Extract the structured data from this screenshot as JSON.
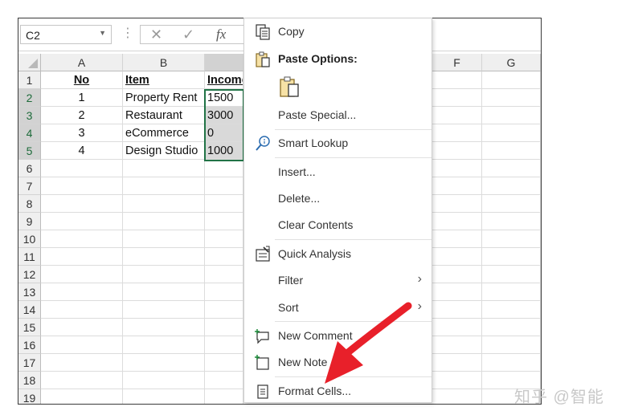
{
  "name_box": {
    "value": "C2"
  },
  "formula_bar": {
    "cancel": "✕",
    "enter": "✓",
    "fx": "fx"
  },
  "columns": [
    "A",
    "B",
    "Income",
    "",
    "",
    "F",
    "G"
  ],
  "rows": [
    "1",
    "2",
    "3",
    "4",
    "5",
    "6",
    "7",
    "8",
    "9",
    "10",
    "11",
    "12",
    "13",
    "14",
    "15",
    "16",
    "17",
    "18",
    "19"
  ],
  "table": {
    "headers": [
      "No",
      "Item",
      "Income"
    ],
    "data": [
      [
        "1",
        "Property Rent",
        "1500"
      ],
      [
        "2",
        "Restaurant",
        "3000"
      ],
      [
        "3",
        "eCommerce",
        "0"
      ],
      [
        "4",
        "Design Studio",
        "1000"
      ]
    ]
  },
  "context_menu": {
    "copy": "Copy",
    "paste_options": "Paste Options:",
    "paste_special": "Paste Special...",
    "smart_lookup": "Smart Lookup",
    "insert": "Insert...",
    "delete": "Delete...",
    "clear_contents": "Clear Contents",
    "quick_analysis": "Quick Analysis",
    "filter": "Filter",
    "sort": "Sort",
    "new_comment": "New Comment",
    "new_note": "New Note",
    "format_cells": "Format Cells..."
  },
  "colors": {
    "selection": "#217346",
    "arrow": "#e8202a"
  },
  "watermark": "知乎 @智能"
}
